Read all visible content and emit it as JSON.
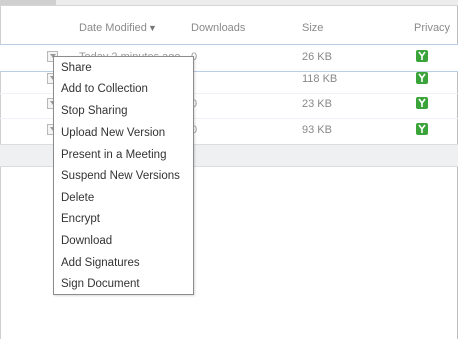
{
  "columns": {
    "date_modified": "Date Modified",
    "sort_arrow": "▼",
    "downloads": "Downloads",
    "size": "Size",
    "privacy": "Privacy"
  },
  "rows": [
    {
      "date": "Today 2 minutes ago",
      "downloads": "0",
      "size": "26 KB",
      "privacy_icon": "privacy-icon"
    },
    {
      "date": "",
      "downloads": "",
      "size": "118 KB",
      "privacy_icon": "privacy-icon"
    },
    {
      "date": "",
      "downloads": "0",
      "size": "23 KB",
      "privacy_icon": "privacy-icon"
    },
    {
      "date": "",
      "downloads": "0",
      "size": "93 KB",
      "privacy_icon": "privacy-icon"
    }
  ],
  "context_menu": {
    "items": [
      "Share",
      "Add to Collection",
      "Stop Sharing",
      "Upload New Version",
      "Present in a Meeting",
      "Suspend New Versions",
      "Delete",
      "Encrypt",
      "Download",
      "Add Signatures",
      "Sign Document"
    ]
  },
  "colors": {
    "privacy_green": "#3aa33a",
    "selected_row_border": "#b9cde4"
  }
}
